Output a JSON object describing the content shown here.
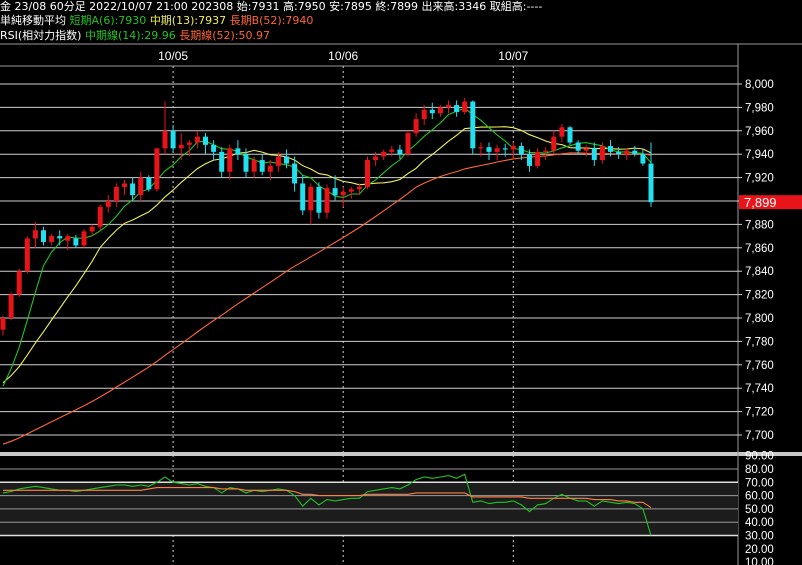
{
  "header": {
    "line1": "金 23/08 60分足 2022/10/07 21:00 202308 始:7931 高:7950 安:7895 終:7899 出来高:3346 取組高:----",
    "ma_title": "単純移動平均",
    "ma_short": "短期A(6):7930",
    "ma_mid": "中期(13):7937",
    "ma_long": "長期B(52):7940",
    "rsi_title": "RSI(相対力指数)",
    "rsi_mid": "中期線(14):29.96",
    "rsi_long": "長期線(52):50.97"
  },
  "colors": {
    "up": "#e8141a",
    "down": "#22e0f0",
    "ma_short": "#22c322",
    "ma_mid": "#f0f05a",
    "ma_long": "#ff6633",
    "rsi_mid": "#22c322",
    "rsi_long": "#ff8040",
    "price_tag_bg": "#e8141a"
  },
  "chart_data": [
    {
      "type": "candlestick",
      "x_labels": [
        "10/05",
        "10/06",
        "10/07"
      ],
      "y_ticks": [
        "8,000",
        "7,980",
        "7,960",
        "7,940",
        "7,920",
        "7,900",
        "7,880",
        "7,860",
        "7,840",
        "7,820",
        "7,800",
        "7,780",
        "7,760",
        "7,740",
        "7,720",
        "7,700"
      ],
      "ylim": [
        7690,
        8010
      ],
      "last_price": "7,899",
      "candles": [
        [
          7790,
          7802,
          7785,
          7800
        ],
        [
          7800,
          7822,
          7798,
          7820
        ],
        [
          7820,
          7842,
          7818,
          7840
        ],
        [
          7840,
          7870,
          7838,
          7868
        ],
        [
          7868,
          7882,
          7860,
          7875
        ],
        [
          7875,
          7878,
          7862,
          7865
        ],
        [
          7865,
          7872,
          7862,
          7870
        ],
        [
          7870,
          7875,
          7862,
          7868
        ],
        [
          7866,
          7872,
          7858,
          7870
        ],
        [
          7868,
          7871,
          7860,
          7862
        ],
        [
          7862,
          7876,
          7860,
          7874
        ],
        [
          7874,
          7880,
          7870,
          7878
        ],
        [
          7878,
          7897,
          7875,
          7895
        ],
        [
          7895,
          7905,
          7890,
          7900
        ],
        [
          7900,
          7915,
          7895,
          7912
        ],
        [
          7912,
          7918,
          7905,
          7915
        ],
        [
          7915,
          7920,
          7900,
          7905
        ],
        [
          7905,
          7925,
          7900,
          7920
        ],
        [
          7920,
          7922,
          7908,
          7910
        ],
        [
          7910,
          7945,
          7908,
          7945
        ],
        [
          7945,
          7985,
          7940,
          7960
        ],
        [
          7960,
          7965,
          7942,
          7945
        ],
        [
          7945,
          7958,
          7935,
          7948
        ],
        [
          7948,
          7952,
          7938,
          7950
        ],
        [
          7950,
          7960,
          7945,
          7955
        ],
        [
          7955,
          7958,
          7940,
          7948
        ],
        [
          7948,
          7952,
          7935,
          7942
        ],
        [
          7942,
          7946,
          7920,
          7925
        ],
        [
          7925,
          7948,
          7918,
          7945
        ],
        [
          7945,
          7952,
          7935,
          7940
        ],
        [
          7940,
          7945,
          7920,
          7925
        ],
        [
          7925,
          7938,
          7920,
          7935
        ],
        [
          7935,
          7940,
          7922,
          7925
        ],
        [
          7925,
          7935,
          7918,
          7930
        ],
        [
          7930,
          7942,
          7925,
          7938
        ],
        [
          7938,
          7944,
          7928,
          7932
        ],
        [
          7932,
          7938,
          7908,
          7915
        ],
        [
          7915,
          7922,
          7888,
          7892
        ],
        [
          7892,
          7915,
          7880,
          7912
        ],
        [
          7912,
          7916,
          7885,
          7890
        ],
        [
          7890,
          7914,
          7885,
          7911
        ],
        [
          7911,
          7922,
          7900,
          7905
        ],
        [
          7905,
          7912,
          7895,
          7908
        ],
        [
          7908,
          7912,
          7902,
          7910
        ],
        [
          7910,
          7915,
          7905,
          7912
        ],
        [
          7912,
          7938,
          7910,
          7935
        ],
        [
          7935,
          7942,
          7930,
          7938
        ],
        [
          7938,
          7944,
          7935,
          7942
        ],
        [
          7942,
          7947,
          7938,
          7944
        ],
        [
          7944,
          7948,
          7936,
          7940
        ],
        [
          7940,
          7960,
          7938,
          7958
        ],
        [
          7958,
          7975,
          7955,
          7970
        ],
        [
          7970,
          7982,
          7965,
          7978
        ],
        [
          7978,
          7984,
          7970,
          7975
        ],
        [
          7975,
          7982,
          7972,
          7980
        ],
        [
          7980,
          7986,
          7975,
          7982
        ],
        [
          7982,
          7986,
          7972,
          7976
        ],
        [
          7976,
          7988,
          7974,
          7985
        ],
        [
          7985,
          7986,
          7940,
          7945
        ],
        [
          7945,
          7950,
          7938,
          7946
        ],
        [
          7946,
          7950,
          7935,
          7942
        ],
        [
          7942,
          7948,
          7935,
          7945
        ],
        [
          7945,
          7949,
          7938,
          7944
        ],
        [
          7944,
          7950,
          7936,
          7947
        ],
        [
          7947,
          7950,
          7935,
          7940
        ],
        [
          7940,
          7944,
          7925,
          7930
        ],
        [
          7930,
          7945,
          7928,
          7942
        ],
        [
          7942,
          7946,
          7935,
          7943
        ],
        [
          7943,
          7960,
          7940,
          7955
        ],
        [
          7955,
          7966,
          7950,
          7963
        ],
        [
          7963,
          7964,
          7948,
          7950
        ],
        [
          7950,
          7952,
          7940,
          7943
        ],
        [
          7943,
          7948,
          7938,
          7945
        ],
        [
          7945,
          7950,
          7930,
          7935
        ],
        [
          7935,
          7950,
          7932,
          7947
        ],
        [
          7947,
          7952,
          7938,
          7942
        ],
        [
          7942,
          7946,
          7936,
          7940
        ],
        [
          7940,
          7945,
          7935,
          7943
        ],
        [
          7943,
          7947,
          7938,
          7940
        ],
        [
          7940,
          7944,
          7930,
          7932
        ],
        [
          7932,
          7950,
          7895,
          7899
        ]
      ]
    },
    {
      "type": "line",
      "y_ticks": [
        "90.00",
        "80.00",
        "70.00",
        "60.00",
        "50.00",
        "40.00",
        "30.00",
        "20.00",
        "10.00"
      ],
      "ylim": [
        7,
        93
      ],
      "series": [
        {
          "name": "中期線(14)",
          "values": [
            62,
            63,
            65,
            66,
            67,
            66,
            65,
            64,
            64,
            63,
            64,
            65,
            66,
            67,
            68,
            68,
            67,
            68,
            67,
            70,
            74,
            70,
            69,
            68,
            69,
            67,
            66,
            62,
            66,
            65,
            62,
            64,
            63,
            64,
            65,
            64,
            60,
            52,
            58,
            53,
            57,
            56,
            57,
            58,
            58,
            63,
            64,
            65,
            66,
            65,
            68,
            72,
            74,
            73,
            74,
            75,
            73,
            76,
            55,
            56,
            54,
            55,
            55,
            56,
            53,
            48,
            53,
            54,
            58,
            61,
            58,
            56,
            56,
            52,
            56,
            55,
            54,
            55,
            54,
            50,
            30
          ]
        },
        {
          "name": "長期線(52)",
          "values": [
            64,
            64,
            64,
            64,
            64,
            64,
            64,
            64,
            64,
            64,
            64,
            64,
            64,
            64,
            64,
            64,
            64,
            64,
            65,
            66,
            66,
            66,
            66,
            66,
            66,
            66,
            66,
            65,
            65,
            65,
            64,
            64,
            64,
            64,
            64,
            64,
            63,
            61,
            61,
            60,
            60,
            60,
            60,
            60,
            60,
            61,
            61,
            61,
            61,
            61,
            61,
            62,
            62,
            62,
            62,
            62,
            62,
            62,
            59,
            59,
            59,
            59,
            59,
            59,
            59,
            58,
            58,
            58,
            58,
            58,
            58,
            58,
            58,
            57,
            57,
            57,
            56,
            56,
            55,
            55,
            51
          ]
        }
      ]
    }
  ]
}
